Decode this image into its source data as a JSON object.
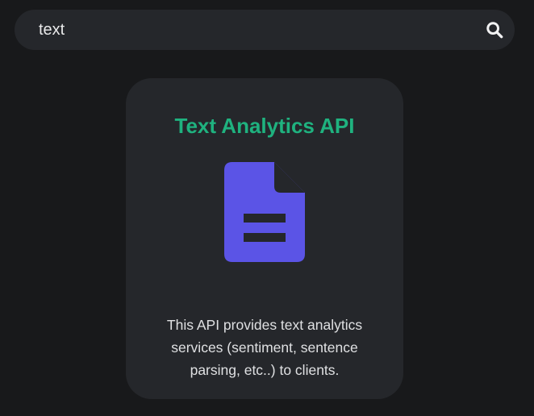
{
  "search": {
    "value": "text"
  },
  "card": {
    "title": "Text Analytics API",
    "description": "This API provides text analytics services (sentiment, sentence parsing, etc..) to clients."
  },
  "icons": {
    "search": "search-icon",
    "card": "file-document-icon"
  },
  "colors": {
    "background": "#18191b",
    "surface": "#25272b",
    "title": "#1fb27f",
    "icon": "#5b54e6",
    "text": "#dfe0e2"
  }
}
